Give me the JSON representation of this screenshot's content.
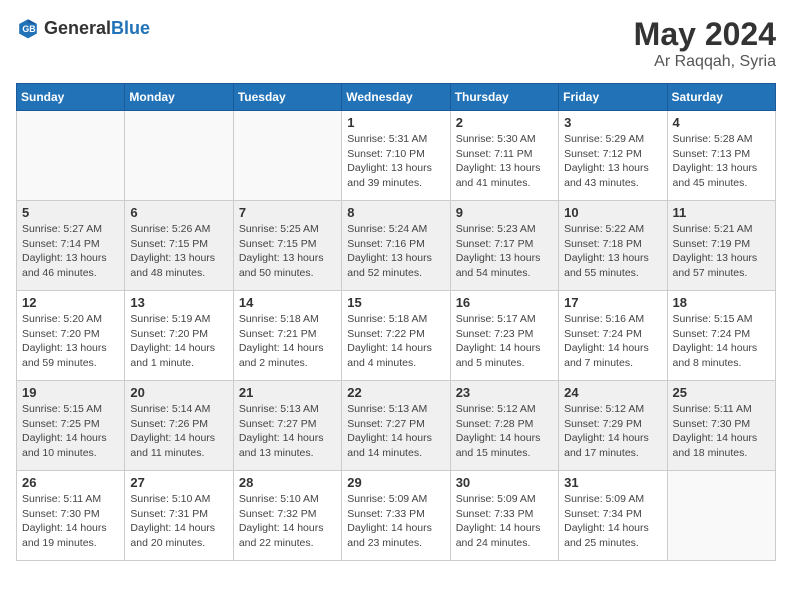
{
  "header": {
    "logo_general": "General",
    "logo_blue": "Blue",
    "title": "May 2024",
    "location": "Ar Raqqah, Syria"
  },
  "weekdays": [
    "Sunday",
    "Monday",
    "Tuesday",
    "Wednesday",
    "Thursday",
    "Friday",
    "Saturday"
  ],
  "weeks": [
    [
      {
        "day": "",
        "info": ""
      },
      {
        "day": "",
        "info": ""
      },
      {
        "day": "",
        "info": ""
      },
      {
        "day": "1",
        "info": "Sunrise: 5:31 AM\nSunset: 7:10 PM\nDaylight: 13 hours\nand 39 minutes."
      },
      {
        "day": "2",
        "info": "Sunrise: 5:30 AM\nSunset: 7:11 PM\nDaylight: 13 hours\nand 41 minutes."
      },
      {
        "day": "3",
        "info": "Sunrise: 5:29 AM\nSunset: 7:12 PM\nDaylight: 13 hours\nand 43 minutes."
      },
      {
        "day": "4",
        "info": "Sunrise: 5:28 AM\nSunset: 7:13 PM\nDaylight: 13 hours\nand 45 minutes."
      }
    ],
    [
      {
        "day": "5",
        "info": "Sunrise: 5:27 AM\nSunset: 7:14 PM\nDaylight: 13 hours\nand 46 minutes."
      },
      {
        "day": "6",
        "info": "Sunrise: 5:26 AM\nSunset: 7:15 PM\nDaylight: 13 hours\nand 48 minutes."
      },
      {
        "day": "7",
        "info": "Sunrise: 5:25 AM\nSunset: 7:15 PM\nDaylight: 13 hours\nand 50 minutes."
      },
      {
        "day": "8",
        "info": "Sunrise: 5:24 AM\nSunset: 7:16 PM\nDaylight: 13 hours\nand 52 minutes."
      },
      {
        "day": "9",
        "info": "Sunrise: 5:23 AM\nSunset: 7:17 PM\nDaylight: 13 hours\nand 54 minutes."
      },
      {
        "day": "10",
        "info": "Sunrise: 5:22 AM\nSunset: 7:18 PM\nDaylight: 13 hours\nand 55 minutes."
      },
      {
        "day": "11",
        "info": "Sunrise: 5:21 AM\nSunset: 7:19 PM\nDaylight: 13 hours\nand 57 minutes."
      }
    ],
    [
      {
        "day": "12",
        "info": "Sunrise: 5:20 AM\nSunset: 7:20 PM\nDaylight: 13 hours\nand 59 minutes."
      },
      {
        "day": "13",
        "info": "Sunrise: 5:19 AM\nSunset: 7:20 PM\nDaylight: 14 hours\nand 1 minute."
      },
      {
        "day": "14",
        "info": "Sunrise: 5:18 AM\nSunset: 7:21 PM\nDaylight: 14 hours\nand 2 minutes."
      },
      {
        "day": "15",
        "info": "Sunrise: 5:18 AM\nSunset: 7:22 PM\nDaylight: 14 hours\nand 4 minutes."
      },
      {
        "day": "16",
        "info": "Sunrise: 5:17 AM\nSunset: 7:23 PM\nDaylight: 14 hours\nand 5 minutes."
      },
      {
        "day": "17",
        "info": "Sunrise: 5:16 AM\nSunset: 7:24 PM\nDaylight: 14 hours\nand 7 minutes."
      },
      {
        "day": "18",
        "info": "Sunrise: 5:15 AM\nSunset: 7:24 PM\nDaylight: 14 hours\nand 8 minutes."
      }
    ],
    [
      {
        "day": "19",
        "info": "Sunrise: 5:15 AM\nSunset: 7:25 PM\nDaylight: 14 hours\nand 10 minutes."
      },
      {
        "day": "20",
        "info": "Sunrise: 5:14 AM\nSunset: 7:26 PM\nDaylight: 14 hours\nand 11 minutes."
      },
      {
        "day": "21",
        "info": "Sunrise: 5:13 AM\nSunset: 7:27 PM\nDaylight: 14 hours\nand 13 minutes."
      },
      {
        "day": "22",
        "info": "Sunrise: 5:13 AM\nSunset: 7:27 PM\nDaylight: 14 hours\nand 14 minutes."
      },
      {
        "day": "23",
        "info": "Sunrise: 5:12 AM\nSunset: 7:28 PM\nDaylight: 14 hours\nand 15 minutes."
      },
      {
        "day": "24",
        "info": "Sunrise: 5:12 AM\nSunset: 7:29 PM\nDaylight: 14 hours\nand 17 minutes."
      },
      {
        "day": "25",
        "info": "Sunrise: 5:11 AM\nSunset: 7:30 PM\nDaylight: 14 hours\nand 18 minutes."
      }
    ],
    [
      {
        "day": "26",
        "info": "Sunrise: 5:11 AM\nSunset: 7:30 PM\nDaylight: 14 hours\nand 19 minutes."
      },
      {
        "day": "27",
        "info": "Sunrise: 5:10 AM\nSunset: 7:31 PM\nDaylight: 14 hours\nand 20 minutes."
      },
      {
        "day": "28",
        "info": "Sunrise: 5:10 AM\nSunset: 7:32 PM\nDaylight: 14 hours\nand 22 minutes."
      },
      {
        "day": "29",
        "info": "Sunrise: 5:09 AM\nSunset: 7:33 PM\nDaylight: 14 hours\nand 23 minutes."
      },
      {
        "day": "30",
        "info": "Sunrise: 5:09 AM\nSunset: 7:33 PM\nDaylight: 14 hours\nand 24 minutes."
      },
      {
        "day": "31",
        "info": "Sunrise: 5:09 AM\nSunset: 7:34 PM\nDaylight: 14 hours\nand 25 minutes."
      },
      {
        "day": "",
        "info": ""
      }
    ]
  ]
}
